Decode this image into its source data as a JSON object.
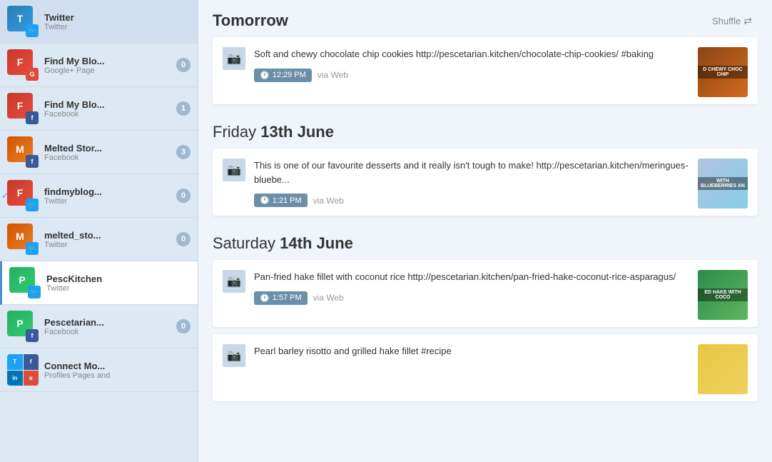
{
  "sidebar": {
    "items": [
      {
        "id": "twitter-1",
        "name": "Twitter",
        "type": "Twitter",
        "avatar_color": "blue",
        "avatar_letter": "T",
        "badge_type": "twitter",
        "count": null,
        "active": false,
        "checked": false
      },
      {
        "id": "findmyblo-google",
        "name": "Find My Blo...",
        "type": "Google+ Page",
        "avatar_color": "red",
        "avatar_letter": "F",
        "badge_type": "google",
        "count": "0",
        "active": false,
        "checked": false
      },
      {
        "id": "findmyblo-facebook",
        "name": "Find My Blo...",
        "type": "Facebook",
        "avatar_color": "red",
        "avatar_letter": "F",
        "badge_type": "facebook",
        "count": "1",
        "active": false,
        "checked": false
      },
      {
        "id": "meltedstory-facebook",
        "name": "Melted Stor...",
        "type": "Facebook",
        "avatar_color": "orange",
        "avatar_letter": "M",
        "badge_type": "facebook",
        "count": "3",
        "active": false,
        "checked": false
      },
      {
        "id": "findmyblog-twitter",
        "name": "findmyblog...",
        "type": "Twitter",
        "avatar_color": "red",
        "avatar_letter": "F",
        "badge_type": "twitter",
        "count": "0",
        "active": false,
        "checked": true
      },
      {
        "id": "melted-twitter",
        "name": "melted_sto...",
        "type": "Twitter",
        "avatar_color": "orange",
        "avatar_letter": "M",
        "badge_type": "twitter",
        "count": "0",
        "active": false,
        "checked": false
      },
      {
        "id": "pesckitchen-twitter",
        "name": "PescKitchen",
        "type": "Twitter",
        "avatar_color": "green",
        "avatar_letter": "P",
        "badge_type": "twitter",
        "count": null,
        "active": true,
        "checked": false
      },
      {
        "id": "pescetarian-facebook",
        "name": "Pescetarian...",
        "type": "Facebook",
        "avatar_color": "green",
        "avatar_letter": "P",
        "badge_type": "facebook",
        "count": "0",
        "active": false,
        "checked": false
      },
      {
        "id": "connect-more",
        "name": "Connect Mo...",
        "type": "Profiles Pages and",
        "avatar_color": "multi",
        "avatar_letter": "",
        "badge_type": null,
        "count": null,
        "active": false,
        "checked": false
      }
    ]
  },
  "main": {
    "sections": [
      {
        "id": "tomorrow",
        "title_plain": "Tomorrow",
        "title_bold": "",
        "shuffle_label": "Shuffle",
        "posts": [
          {
            "id": "post-1",
            "text": "Soft and chewy chocolate chip cookies http://pescetarian.kitchen/chocolate-chip-cookies/ #baking",
            "time": "12:29 PM",
            "via": "via Web",
            "thumb_label": "D CHEWY CHOC CHIP",
            "thumb_class": "thumb-choc"
          }
        ]
      },
      {
        "id": "friday",
        "title_plain": "Friday ",
        "title_bold": "13th June",
        "shuffle_label": "",
        "posts": [
          {
            "id": "post-2",
            "text": "This is one of our favourite desserts and it really isn't tough to make! http://pescetarian.kitchen/meringues-bluebe...",
            "time": "1:21 PM",
            "via": "via Web",
            "thumb_label": "WITH BLUEBERRIES AN",
            "thumb_class": "thumb-blue"
          }
        ]
      },
      {
        "id": "saturday",
        "title_plain": "Saturday ",
        "title_bold": "14th June",
        "shuffle_label": "",
        "posts": [
          {
            "id": "post-3",
            "text": "Pan-fried hake fillet with coconut rice http://pescetarian.kitchen/pan-fried-hake-coconut-rice-asparagus/",
            "time": "1:57 PM",
            "via": "via Web",
            "thumb_label": "ED HAKE WITH COCO",
            "thumb_class": "thumb-hake"
          },
          {
            "id": "post-4",
            "text": "Pearl barley risotto and grilled hake fillet #recipe",
            "time": "",
            "via": "",
            "thumb_label": "",
            "thumb_class": "thumb-barley"
          }
        ]
      }
    ]
  }
}
